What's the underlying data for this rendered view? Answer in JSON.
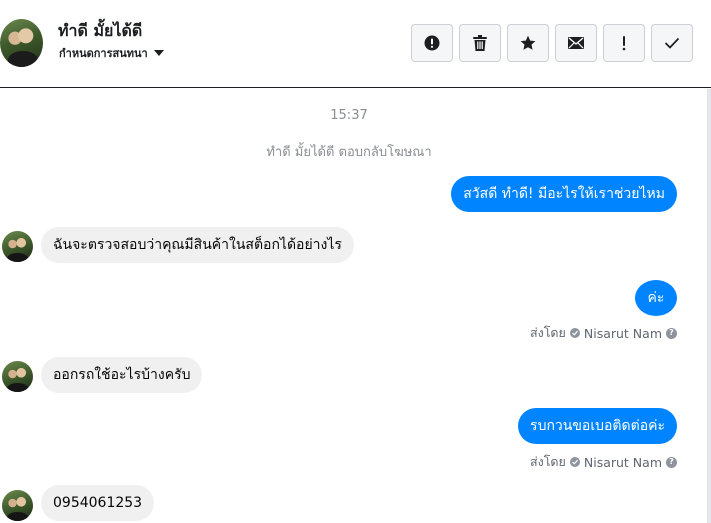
{
  "header": {
    "title": "ทำดี มั้ยได้ดี",
    "subtitle": "กำหนดการสนทนา",
    "actions": [
      {
        "icon": "alert-icon"
      },
      {
        "icon": "trash-icon"
      },
      {
        "icon": "star-icon"
      },
      {
        "icon": "envelope-icon"
      },
      {
        "icon": "exclamation-icon"
      },
      {
        "icon": "checkmark-icon"
      }
    ]
  },
  "thread": {
    "timestamp": "15:37",
    "system_message": "ทำดี มั้ยได้ดี ตอบกลับโฆษณา",
    "messages": [
      {
        "direction": "out",
        "text": "สวัสดี ทำดี! มีอะไรให้เราช่วยไหม"
      },
      {
        "direction": "in",
        "text": "ฉันจะตรวจสอบว่าคุณมีสินค้าในสต็อกได้อย่างไร"
      },
      {
        "direction": "out",
        "text": "ค่ะ"
      },
      {
        "direction": "in",
        "text": "ออกรถใช้อะไรบ้างครับ"
      },
      {
        "direction": "out",
        "text": "รบกวนขอเบอติดต่อค่ะ"
      },
      {
        "direction": "in",
        "text": "0954061253"
      }
    ],
    "sent_by_label": "ส่งโดย",
    "sent_by_name": "Nisarut Nam",
    "help_glyph": "?"
  },
  "colors": {
    "outgoing_bubble": "#0084ff",
    "incoming_bubble": "#f0f0f0",
    "muted_text": "#8a8d91"
  }
}
